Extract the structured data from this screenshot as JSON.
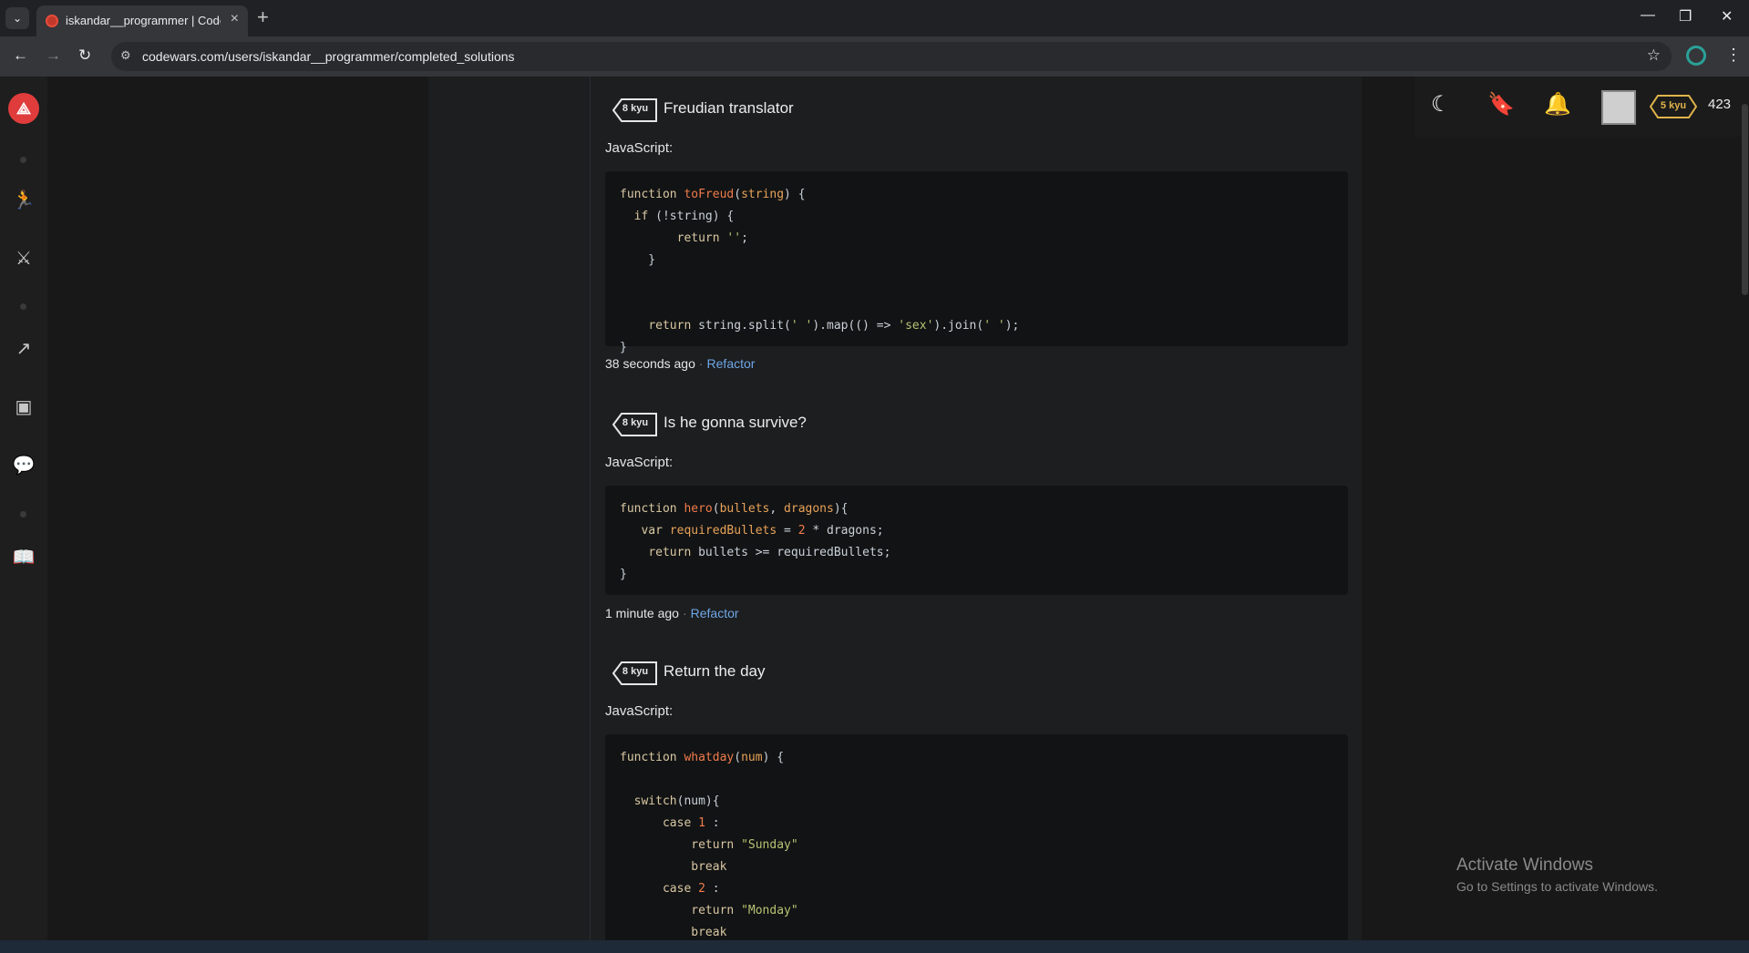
{
  "browser": {
    "tab_title": "iskandar__programmer | Codewars",
    "url": "codewars.com/users/iskandar__programmer/completed_solutions"
  },
  "hud": {
    "rank": "5 kyu",
    "honor": "423"
  },
  "katas": [
    {
      "kyu": "8 kyu",
      "name": "Freudian translator",
      "language": "JavaScript:",
      "time_ago": "38 seconds ago",
      "action": "Refactor"
    },
    {
      "kyu": "8 kyu",
      "name": "Is he gonna survive?",
      "language": "JavaScript:",
      "time_ago": "1 minute ago",
      "action": "Refactor"
    },
    {
      "kyu": "8 kyu",
      "name": "Return the day",
      "language": "JavaScript:"
    }
  ],
  "activation": {
    "title": "Activate Windows",
    "subtitle": "Go to Settings to activate Windows."
  },
  "icons": {
    "nav": [
      "codewars-logo-icon",
      "training-icon",
      "practice-icon",
      "leaderboard-icon",
      "discord-icon",
      "discussions-icon",
      "docs-icon"
    ],
    "hud": [
      "moon-icon",
      "bookmark-icon",
      "bell-icon"
    ]
  }
}
